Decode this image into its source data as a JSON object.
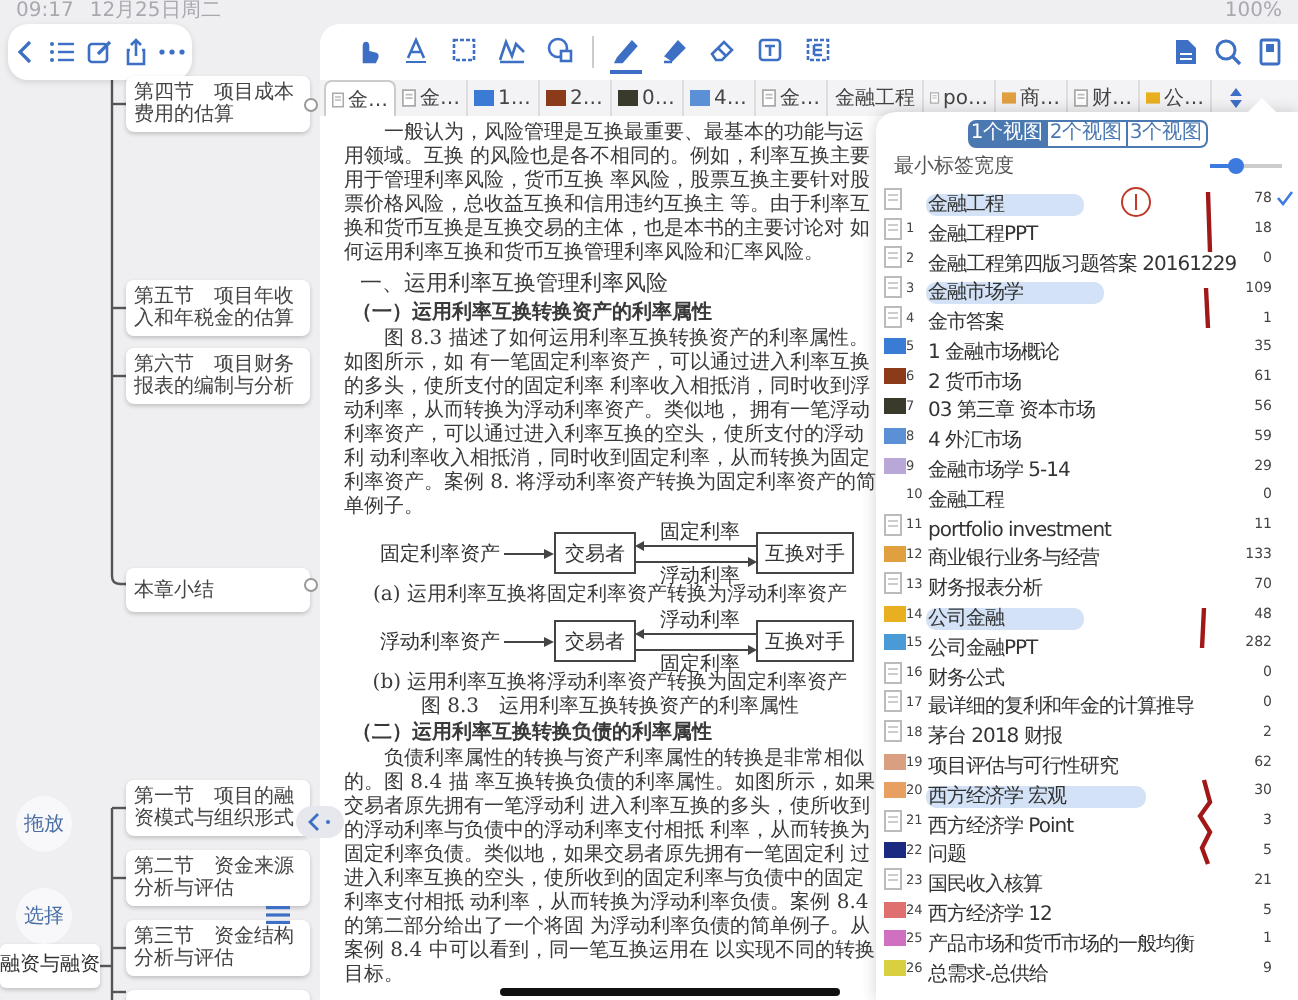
{
  "status_bar": {
    "time": "09:17",
    "date": "12月25日周二",
    "battery": "100%"
  },
  "mindmap": {
    "nodes": [
      {
        "text": "第四节　项目成本费用的估算"
      },
      {
        "text": "第五节　项目年收入和年税金的估算"
      },
      {
        "text": "第六节　项目财务报表的编制与分析"
      },
      {
        "text": "本章小结"
      },
      {
        "text": "第一节　项目的融资模式与组织形式"
      },
      {
        "text": "第二节　资金来源分析与评估"
      },
      {
        "text": "第三节　资金结构分析与评估"
      }
    ],
    "parent_node": {
      "text": "融资与融资"
    },
    "actions": [
      {
        "label": "拖放"
      },
      {
        "label": "选择"
      }
    ]
  },
  "reader": {
    "tools": [
      {
        "kind": "hand",
        "selected": false
      },
      {
        "kind": "text",
        "selected": false
      },
      {
        "kind": "rect",
        "selected": false
      },
      {
        "kind": "signature",
        "selected": false
      },
      {
        "kind": "lasso",
        "selected": false
      },
      {
        "kind": "pen",
        "selected": true
      },
      {
        "kind": "highlighter",
        "selected": false
      },
      {
        "kind": "eraser",
        "selected": false
      },
      {
        "kind": "textbox",
        "selected": false
      },
      {
        "kind": "note",
        "selected": false
      }
    ],
    "tabs": [
      {
        "label": "金…",
        "kind": "page",
        "selected": true
      },
      {
        "label": "金…",
        "kind": "page",
        "selected": false
      },
      {
        "label": "1…",
        "kind": "image",
        "color": "#3a7bd5",
        "selected": false
      },
      {
        "label": "2…",
        "kind": "image",
        "color": "#8b3a1a",
        "selected": false
      },
      {
        "label": "0…",
        "kind": "image",
        "color": "#3a3a2a",
        "selected": false
      },
      {
        "label": "4…",
        "kind": "image",
        "color": "#5b8fd6",
        "selected": false
      },
      {
        "label": "金…",
        "kind": "page",
        "selected": false
      },
      {
        "label": "金融工程",
        "kind": "none",
        "selected": false
      },
      {
        "label": "po…",
        "kind": "page",
        "selected": false
      },
      {
        "label": "商…",
        "kind": "image",
        "color": "#e0a040",
        "selected": false
      },
      {
        "label": "财…",
        "kind": "page",
        "selected": false
      },
      {
        "label": "公…",
        "kind": "image",
        "color": "#e8b020",
        "selected": false
      }
    ],
    "page": {
      "blocks": [
        {
          "kind": "paragraph",
          "text": "一般认为，风险管理是互换最重要、最基本的功能与运用领域。互换 的风险也是各不相同的。例如，利率互换主要用于管理利率风险，货币互换 率风险，股票互换主要针对股票价格风险，总收益互换和信用违约互换主 等。由于利率互换和货币互换是互换交易的主体，也是本书的主要讨论对 如何运用利率互换和货币互换管理利率风险和汇率风险。"
        },
        {
          "kind": "heading",
          "text": "一、运用利率互换管理利率风险"
        },
        {
          "kind": "subheading",
          "text": "（一）运用利率互换转换资产的利率属性"
        },
        {
          "kind": "paragraph",
          "text": "图 8.3 描述了如何运用利率互换转换资产的利率属性。如图所示，如 有一笔固定利率资产，可以通过进入利率互换的多头，使所支付的固定利率 利率收入相抵消，同时收到浮动利率，从而转换为浮动利率资产。类似地， 拥有一笔浮动利率资产，可以通过进入利率互换的空头，使所支付的浮动利 动利率收入相抵消，同时收到固定利率，从而转换为固定利率资产。案例 8. 将浮动利率资产转换为固定利率资产的简单例子。"
        },
        {
          "kind": "figure",
          "source": "固定利率资产",
          "trader": "交易者",
          "top_rate": "固定利率",
          "bottom_rate": "浮动利率",
          "counterparty": "互换对手",
          "caption": "(a) 运用利率互换将固定利率资产转换为浮动利率资产"
        },
        {
          "kind": "figure",
          "source": "浮动利率资产",
          "trader": "交易者",
          "top_rate": "浮动利率",
          "bottom_rate": "固定利率",
          "counterparty": "互换对手",
          "caption": "(b) 运用利率互换将浮动利率资产转换为固定利率资产"
        },
        {
          "kind": "caption",
          "text": "图 8.3　运用利率互换转换资产的利率属性"
        },
        {
          "kind": "subheading",
          "text": "（二）运用利率互换转换负债的利率属性"
        },
        {
          "kind": "paragraph",
          "text": "负债利率属性的转换与资产利率属性的转换是非常相似的。图 8.4 描 率互换转换负债的利率属性。如图所示，如果交易者原先拥有一笔浮动利 进入利率互换的多头，使所收到的浮动利率与负债中的浮动利率支付相抵 利率，从而转换为固定利率负债。类似地，如果交易者原先拥有一笔固定利 过进入利率互换的空头，使所收到的固定利率与负债中的固定利率支付相抵 动利率，从而转换为浮动利率负债。案例 8.4 的第二部分给出了一个将固 为浮动利率负债的简单例子。从案例 8.4 中可以看到，同一笔互换运用在 以实现不同的转换目标。"
        }
      ]
    }
  },
  "tab_width_popover": {
    "view_modes": [
      {
        "label": "1个视图",
        "selected": true
      },
      {
        "label": "2个视图",
        "selected": false
      },
      {
        "label": "3个视图",
        "selected": false
      }
    ],
    "min_tab_width": {
      "label": "最小标签宽度",
      "level": 0.35
    },
    "rows": [
      {
        "name": "金融工程",
        "count": "78",
        "kind": "page",
        "checked": true,
        "highlighted": true
      },
      {
        "index": "1",
        "name": "金融工程PPT",
        "count": "18",
        "kind": "page",
        "checked": false,
        "highlighted": false
      },
      {
        "index": "2",
        "name": "金融工程第四版习题答案 20161229",
        "count": "0",
        "kind": "page",
        "checked": false,
        "highlighted": false
      },
      {
        "index": "3",
        "name": "金融市场学",
        "count": "109",
        "kind": "page",
        "checked": false,
        "highlighted": true
      },
      {
        "index": "4",
        "name": "金市答案",
        "count": "1",
        "kind": "page",
        "checked": false,
        "highlighted": false
      },
      {
        "index": "5",
        "name": "1 金融市场概论",
        "count": "35",
        "kind": "image",
        "color": "#3a7bd5",
        "checked": false,
        "highlighted": false
      },
      {
        "index": "6",
        "name": "2 货币市场",
        "count": "61",
        "kind": "image",
        "color": "#8b3a1a",
        "checked": false,
        "highlighted": false
      },
      {
        "index": "7",
        "name": "03 第三章 资本市场",
        "count": "56",
        "kind": "image",
        "color": "#3a3a2a",
        "checked": false,
        "highlighted": false
      },
      {
        "index": "8",
        "name": "4 外汇市场",
        "count": "59",
        "kind": "image",
        "color": "#5b8fd6",
        "checked": false,
        "highlighted": false
      },
      {
        "index": "9",
        "name": "金融市场学 5-14",
        "count": "29",
        "kind": "image",
        "color": "#b9a7d8",
        "checked": false,
        "highlighted": false
      },
      {
        "index": "10",
        "name": "金融工程",
        "count": "0",
        "kind": "none",
        "checked": false,
        "highlighted": false
      },
      {
        "index": "11",
        "name": "portfolio investment",
        "count": "11",
        "kind": "page",
        "checked": false,
        "highlighted": false
      },
      {
        "index": "12",
        "name": "商业银行业务与经营",
        "count": "133",
        "kind": "image",
        "color": "#e0a040",
        "checked": false,
        "highlighted": false
      },
      {
        "index": "13",
        "name": "财务报表分析",
        "count": "70",
        "kind": "page",
        "checked": false,
        "highlighted": false
      },
      {
        "index": "14",
        "name": "公司金融",
        "count": "48",
        "kind": "image",
        "color": "#e8b020",
        "checked": false,
        "highlighted": true
      },
      {
        "index": "15",
        "name": "公司金融PPT",
        "count": "282",
        "kind": "image",
        "color": "#4a9ad8",
        "checked": false,
        "highlighted": false
      },
      {
        "index": "16",
        "name": "财务公式",
        "count": "0",
        "kind": "page",
        "checked": false,
        "highlighted": false
      },
      {
        "index": "17",
        "name": "最详细的复利和年金的计算推导",
        "count": "0",
        "kind": "page",
        "checked": false,
        "highlighted": false
      },
      {
        "index": "18",
        "name": "茅台 2018 财报",
        "count": "2",
        "kind": "page",
        "checked": false,
        "highlighted": false
      },
      {
        "index": "19",
        "name": "项目评估与可行性研究",
        "count": "62",
        "kind": "image",
        "color": "#d8a080",
        "checked": false,
        "highlighted": false
      },
      {
        "index": "20",
        "name": "西方经济学 宏观",
        "count": "30",
        "kind": "image",
        "color": "#e8a060",
        "checked": false,
        "highlighted": true
      },
      {
        "index": "21",
        "name": "西方经济学 Point",
        "count": "3",
        "kind": "page",
        "checked": false,
        "highlighted": false
      },
      {
        "index": "22",
        "name": "问题",
        "count": "5",
        "kind": "image",
        "color": "#1a2a80",
        "checked": false,
        "highlighted": false
      },
      {
        "index": "23",
        "name": "国民收入核算",
        "count": "21",
        "kind": "page",
        "checked": false,
        "highlighted": false
      },
      {
        "index": "24",
        "name": "西方经济学 12",
        "count": "5",
        "kind": "image",
        "color": "#e07070",
        "checked": false,
        "highlighted": false
      },
      {
        "index": "25",
        "name": "产品市场和货币市场的一般均衡",
        "count": "1",
        "kind": "image",
        "color": "#d070c0",
        "checked": false,
        "highlighted": false
      },
      {
        "index": "26",
        "name": "总需求-总供给",
        "count": "9",
        "kind": "image",
        "color": "#d8d040",
        "checked": false,
        "highlighted": false
      }
    ]
  }
}
